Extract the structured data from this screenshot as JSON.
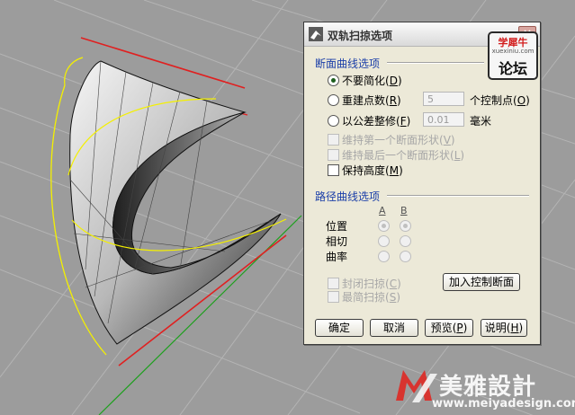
{
  "dialog": {
    "title": "双轨扫掠选项",
    "close_glyph": "×",
    "badge": {
      "top": "学犀牛",
      "site": "xuexiniu.com",
      "bottom": "论坛"
    }
  },
  "section_curve": {
    "title": "断面曲线选项",
    "options": [
      {
        "label": "不要简化",
        "shortcut": "D",
        "checked": true
      },
      {
        "label": "重建点数",
        "shortcut": "R",
        "checked": false
      },
      {
        "label": "以公差整修",
        "shortcut": "F",
        "checked": false
      }
    ],
    "rebuild": {
      "value": "5",
      "unit": "个控制点",
      "unit_shortcut": "O"
    },
    "refit": {
      "value": "0.01",
      "unit": "毫米"
    },
    "checks": [
      {
        "label": "维持第一个断面形状",
        "shortcut": "V",
        "enabled": false
      },
      {
        "label": "维持最后一个断面形状",
        "shortcut": "L",
        "enabled": false
      },
      {
        "label": "保持高度",
        "shortcut": "M",
        "enabled": true
      }
    ]
  },
  "section_rail": {
    "title": "路径曲线选项",
    "col_a": "A",
    "col_b": "B",
    "rows": [
      "位置",
      "相切",
      "曲率"
    ]
  },
  "sweep_checks": [
    {
      "label": "封闭扫掠",
      "shortcut": "C"
    },
    {
      "label": "最简扫掠",
      "shortcut": "S"
    }
  ],
  "buttons": {
    "add_section": "加入控制断面",
    "ok": "确定",
    "cancel": "取消",
    "preview": "预览",
    "preview_shortcut": "P",
    "help": "说明",
    "help_shortcut": "H"
  },
  "watermark": {
    "brand": "美雅設計",
    "url": "www.meiyadesign.com"
  },
  "colors": {
    "viewport_bg": "#9c9c9c",
    "grid": "#b4b4b4",
    "rail_red": "#e02020",
    "curve_yellow": "#f4f000",
    "axis_green": "#1ea01e",
    "group_title_blue": "#1a3ea8"
  }
}
